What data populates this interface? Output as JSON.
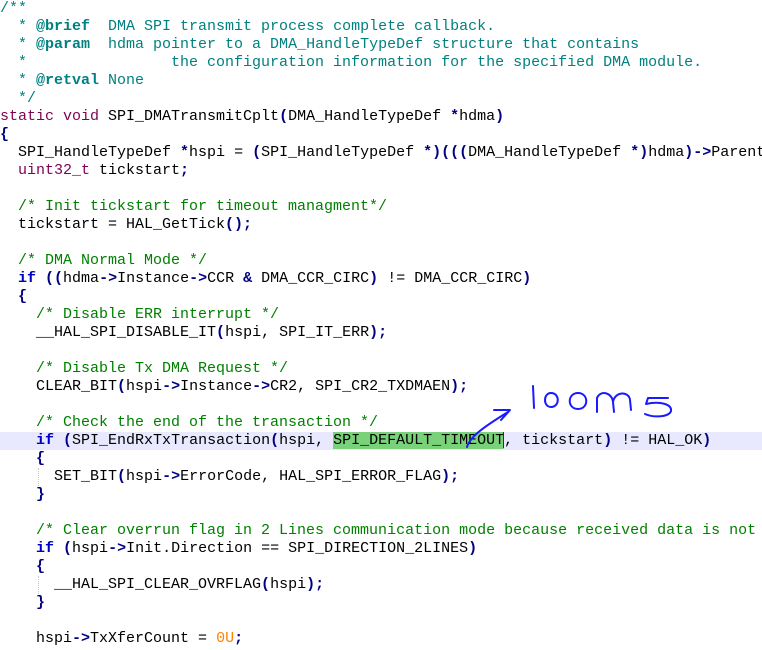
{
  "editor": {
    "lines": [
      [
        {
          "t": "/**",
          "c": "doc"
        }
      ],
      [
        {
          "t": "  * ",
          "c": "doc"
        },
        {
          "t": "@brief",
          "c": "tag"
        },
        {
          "t": "  DMA SPI transmit process complete callback.",
          "c": "doc"
        }
      ],
      [
        {
          "t": "  * ",
          "c": "doc"
        },
        {
          "t": "@param",
          "c": "tag"
        },
        {
          "t": "  hdma pointer to a DMA_HandleTypeDef structure that contains",
          "c": "doc"
        }
      ],
      [
        {
          "t": "  *                the configuration information for the specified DMA module.",
          "c": "doc"
        }
      ],
      [
        {
          "t": "  * ",
          "c": "doc"
        },
        {
          "t": "@retval",
          "c": "tag"
        },
        {
          "t": " None",
          "c": "doc"
        }
      ],
      [
        {
          "t": "  */",
          "c": "doc"
        }
      ],
      [
        {
          "t": "static void",
          "c": "kw"
        },
        {
          "t": " SPI_DMATransmitCplt",
          "c": "txt"
        },
        {
          "t": "(",
          "c": "op"
        },
        {
          "t": "DMA_HandleTypeDef ",
          "c": "txt"
        },
        {
          "t": "*",
          "c": "op"
        },
        {
          "t": "hdma",
          "c": "txt"
        },
        {
          "t": ")",
          "c": "op"
        }
      ],
      [
        {
          "t": "{",
          "c": "op"
        }
      ],
      [
        {
          "t": "  SPI_HandleTypeDef ",
          "c": "txt"
        },
        {
          "t": "*",
          "c": "op"
        },
        {
          "t": "hspi ",
          "c": "txt"
        },
        {
          "t": "=",
          "c": "txt"
        },
        {
          "t": " ",
          "c": "txt"
        },
        {
          "t": "(",
          "c": "op"
        },
        {
          "t": "SPI_HandleTypeDef ",
          "c": "txt"
        },
        {
          "t": "*)(((",
          "c": "op"
        },
        {
          "t": "DMA_HandleTypeDef ",
          "c": "txt"
        },
        {
          "t": "*)",
          "c": "op"
        },
        {
          "t": "hdma",
          "c": "txt"
        },
        {
          "t": ")->",
          "c": "op"
        },
        {
          "t": "Parent",
          "c": "txt"
        }
      ],
      [
        {
          "t": "  uint32_t",
          "c": "ty"
        },
        {
          "t": " tickstart",
          "c": "txt"
        },
        {
          "t": ";",
          "c": "op"
        }
      ],
      [
        {
          "t": "",
          "c": "txt"
        }
      ],
      [
        {
          "t": "  /* Init tickstart for timeout managment*/",
          "c": "c2"
        }
      ],
      [
        {
          "t": "  tickstart = HAL_GetTick",
          "c": "txt"
        },
        {
          "t": "();",
          "c": "op"
        }
      ],
      [
        {
          "t": "",
          "c": "txt"
        }
      ],
      [
        {
          "t": "  /* DMA Normal Mode */",
          "c": "c2"
        }
      ],
      [
        {
          "t": "  if",
          "c": "kwb"
        },
        {
          "t": " ",
          "c": "txt"
        },
        {
          "t": "((",
          "c": "op"
        },
        {
          "t": "hdma",
          "c": "txt"
        },
        {
          "t": "->",
          "c": "op"
        },
        {
          "t": "Instance",
          "c": "txt"
        },
        {
          "t": "->",
          "c": "op"
        },
        {
          "t": "CCR ",
          "c": "txt"
        },
        {
          "t": "&",
          "c": "op"
        },
        {
          "t": " DMA_CCR_CIRC",
          "c": "txt"
        },
        {
          "t": ")",
          "c": "op"
        },
        {
          "t": " != DMA_CCR_CIRC",
          "c": "txt"
        },
        {
          "t": ")",
          "c": "op"
        }
      ],
      [
        {
          "t": "  {",
          "c": "op"
        }
      ],
      [
        {
          "t": "    /* Disable ERR interrupt */",
          "c": "c2"
        }
      ],
      [
        {
          "t": "    __HAL_SPI_DISABLE_IT",
          "c": "txt"
        },
        {
          "t": "(",
          "c": "op"
        },
        {
          "t": "hspi, SPI_IT_ERR",
          "c": "txt"
        },
        {
          "t": ");",
          "c": "op"
        }
      ],
      [
        {
          "t": "",
          "c": "txt"
        }
      ],
      [
        {
          "t": "    /* Disable Tx DMA Request */",
          "c": "c2"
        }
      ],
      [
        {
          "t": "    CLEAR_BIT",
          "c": "txt"
        },
        {
          "t": "(",
          "c": "op"
        },
        {
          "t": "hspi",
          "c": "txt"
        },
        {
          "t": "->",
          "c": "op"
        },
        {
          "t": "Instance",
          "c": "txt"
        },
        {
          "t": "->",
          "c": "op"
        },
        {
          "t": "CR2, SPI_CR2_TXDMAEN",
          "c": "txt"
        },
        {
          "t": ");",
          "c": "op"
        }
      ],
      [
        {
          "t": "",
          "c": "txt"
        }
      ],
      [
        {
          "t": "    /* Check the end of the transaction */",
          "c": "c2"
        }
      ],
      [
        {
          "t": "    if",
          "c": "kwb"
        },
        {
          "t": " ",
          "c": "txt"
        },
        {
          "t": "(",
          "c": "op"
        },
        {
          "t": "SPI_EndRxTxTransaction",
          "c": "txt"
        },
        {
          "t": "(",
          "c": "op"
        },
        {
          "t": "hspi, ",
          "c": "txt"
        },
        {
          "t": "SPI_DEFAULT_TIMEOUT",
          "c": "txt hl"
        },
        {
          "t": "",
          "c": "caret"
        },
        {
          "t": ", tickstart",
          "c": "txt"
        },
        {
          "t": ")",
          "c": "op"
        },
        {
          "t": " != HAL_OK",
          "c": "txt"
        },
        {
          "t": ")",
          "c": "op"
        }
      ],
      [
        {
          "t": "    {",
          "c": "op"
        }
      ],
      [
        {
          "t": "      SET_BIT",
          "c": "txt"
        },
        {
          "t": "(",
          "c": "op"
        },
        {
          "t": "hspi",
          "c": "txt"
        },
        {
          "t": "->",
          "c": "op"
        },
        {
          "t": "ErrorCode, HAL_SPI_ERROR_FLAG",
          "c": "txt"
        },
        {
          "t": ");",
          "c": "op"
        }
      ],
      [
        {
          "t": "    }",
          "c": "op"
        }
      ],
      [
        {
          "t": "",
          "c": "txt"
        }
      ],
      [
        {
          "t": "    /* Clear overrun flag in 2 Lines communication mode because received data is not",
          "c": "c2"
        }
      ],
      [
        {
          "t": "    if",
          "c": "kwb"
        },
        {
          "t": " ",
          "c": "txt"
        },
        {
          "t": "(",
          "c": "op"
        },
        {
          "t": "hspi",
          "c": "txt"
        },
        {
          "t": "->",
          "c": "op"
        },
        {
          "t": "Init.Direction == SPI_DIRECTION_2LINES",
          "c": "txt"
        },
        {
          "t": ")",
          "c": "op"
        }
      ],
      [
        {
          "t": "    {",
          "c": "op"
        }
      ],
      [
        {
          "t": "      __HAL_SPI_CLEAR_OVRFLAG",
          "c": "txt"
        },
        {
          "t": "(",
          "c": "op"
        },
        {
          "t": "hspi",
          "c": "txt"
        },
        {
          "t": ");",
          "c": "op"
        }
      ],
      [
        {
          "t": "    }",
          "c": "op"
        }
      ],
      [
        {
          "t": "",
          "c": "txt"
        }
      ],
      [
        {
          "t": "    hspi",
          "c": "txt"
        },
        {
          "t": "->",
          "c": "op"
        },
        {
          "t": "TxXferCount = ",
          "c": "txt"
        },
        {
          "t": "0U",
          "c": "num"
        },
        {
          "t": ";",
          "c": "op"
        }
      ]
    ],
    "current_line_index": 24,
    "highlighted_token": "SPI_DEFAULT_TIMEOUT"
  },
  "annotation": {
    "text": "100ms",
    "color": "#1a1aff",
    "target": "SPI_DEFAULT_TIMEOUT"
  }
}
